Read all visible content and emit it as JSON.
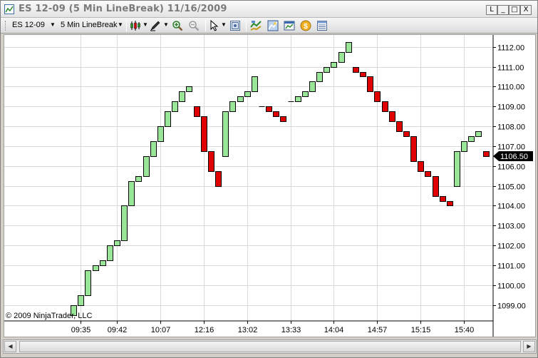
{
  "window": {
    "title": "ES 12-09 (5 Min LineBreak)  11/16/2009",
    "controls": [
      "L",
      "_",
      "□",
      "X"
    ]
  },
  "toolbar": {
    "instrument": "ES 12-09",
    "period": "5 Min LineBreak",
    "icons": [
      "chart-style-icon",
      "draw-pen-icon",
      "zoom-in-icon",
      "zoom-out-icon",
      "pointer-icon",
      "data-box-icon",
      "indicators-icon",
      "strategies-icon",
      "properties-icon",
      "order-icon",
      "list-icon"
    ]
  },
  "chart": {
    "copyright": "© 2009 NinjaTrader, LLC",
    "current_price": "1106.50",
    "colors": {
      "up": "#99e699",
      "down": "#e00000",
      "grid": "#d8d8d8",
      "price_marker": "#000000"
    }
  },
  "chart_data": {
    "type": "line_break",
    "title": "ES 12-09 (5 Min LineBreak)",
    "y_ticks": [
      1099,
      1100,
      1101,
      1102,
      1103,
      1104,
      1105,
      1106,
      1107,
      1108,
      1109,
      1110,
      1111,
      1112
    ],
    "y_tick_labels": [
      "1099.00",
      "1100.00",
      "1101.00",
      "1102.00",
      "1103.00",
      "1104.00",
      "1105.00",
      "1106.00",
      "1107.00",
      "1108.00",
      "1109.00",
      "1110.00",
      "1111.00",
      "1112.00"
    ],
    "ylim": [
      1098.2,
      1112.6
    ],
    "x_labels": [
      "09:35",
      "09:42",
      "10:07",
      "12:16",
      "13:02",
      "13:33",
      "14:04",
      "14:57",
      "15:15",
      "15:40"
    ],
    "x_label_slots": [
      1,
      6,
      12,
      18,
      24,
      30,
      36,
      42,
      48,
      54
    ],
    "slot_count": 60,
    "bricks": [
      {
        "o": 1098.5,
        "c": 1099.0,
        "dir": "up"
      },
      {
        "o": 1099.0,
        "c": 1099.5,
        "dir": "up"
      },
      {
        "o": 1099.5,
        "c": 1100.75,
        "dir": "up"
      },
      {
        "o": 1100.75,
        "c": 1101.0,
        "dir": "up"
      },
      {
        "o": 1101.0,
        "c": 1101.25,
        "dir": "up"
      },
      {
        "o": 1101.25,
        "c": 1102.0,
        "dir": "up"
      },
      {
        "o": 1102.0,
        "c": 1102.25,
        "dir": "up"
      },
      {
        "o": 1102.25,
        "c": 1104.0,
        "dir": "up"
      },
      {
        "o": 1104.0,
        "c": 1105.25,
        "dir": "up"
      },
      {
        "o": 1105.25,
        "c": 1105.5,
        "dir": "up"
      },
      {
        "o": 1105.5,
        "c": 1106.5,
        "dir": "up"
      },
      {
        "o": 1106.5,
        "c": 1107.25,
        "dir": "up"
      },
      {
        "o": 1107.25,
        "c": 1108.0,
        "dir": "up"
      },
      {
        "o": 1108.0,
        "c": 1108.75,
        "dir": "up"
      },
      {
        "o": 1108.75,
        "c": 1109.25,
        "dir": "up"
      },
      {
        "o": 1109.25,
        "c": 1109.75,
        "dir": "up"
      },
      {
        "o": 1109.75,
        "c": 1110.0,
        "dir": "up"
      },
      {
        "o": 1109.0,
        "c": 1108.5,
        "dir": "down"
      },
      {
        "o": 1108.5,
        "c": 1106.75,
        "dir": "down"
      },
      {
        "o": 1106.75,
        "c": 1105.75,
        "dir": "down"
      },
      {
        "o": 1105.75,
        "c": 1105.0,
        "dir": "down"
      },
      {
        "o": 1106.5,
        "c": 1108.75,
        "dir": "up"
      },
      {
        "o": 1108.75,
        "c": 1109.25,
        "dir": "up"
      },
      {
        "o": 1109.25,
        "c": 1109.5,
        "dir": "up"
      },
      {
        "o": 1109.5,
        "c": 1109.75,
        "dir": "up"
      },
      {
        "o": 1109.75,
        "c": 1110.5,
        "dir": "up"
      },
      {
        "o": 1109.0,
        "c": 1109.0,
        "dir": "flat"
      },
      {
        "o": 1109.0,
        "c": 1108.75,
        "dir": "down"
      },
      {
        "o": 1108.75,
        "c": 1108.5,
        "dir": "down"
      },
      {
        "o": 1108.5,
        "c": 1108.25,
        "dir": "down"
      },
      {
        "o": 1109.25,
        "c": 1109.25,
        "dir": "flat"
      },
      {
        "o": 1109.25,
        "c": 1109.5,
        "dir": "up"
      },
      {
        "o": 1109.5,
        "c": 1109.75,
        "dir": "up"
      },
      {
        "o": 1109.75,
        "c": 1110.25,
        "dir": "up"
      },
      {
        "o": 1110.25,
        "c": 1110.75,
        "dir": "up"
      },
      {
        "o": 1110.75,
        "c": 1111.0,
        "dir": "up"
      },
      {
        "o": 1111.0,
        "c": 1111.25,
        "dir": "up"
      },
      {
        "o": 1111.25,
        "c": 1111.75,
        "dir": "up"
      },
      {
        "o": 1111.75,
        "c": 1112.25,
        "dir": "up"
      },
      {
        "o": 1111.0,
        "c": 1110.75,
        "dir": "down"
      },
      {
        "o": 1110.75,
        "c": 1110.5,
        "dir": "down"
      },
      {
        "o": 1110.5,
        "c": 1109.75,
        "dir": "down"
      },
      {
        "o": 1109.75,
        "c": 1109.25,
        "dir": "down"
      },
      {
        "o": 1109.25,
        "c": 1108.75,
        "dir": "down"
      },
      {
        "o": 1108.75,
        "c": 1108.25,
        "dir": "down"
      },
      {
        "o": 1108.25,
        "c": 1107.75,
        "dir": "down"
      },
      {
        "o": 1107.75,
        "c": 1107.5,
        "dir": "down"
      },
      {
        "o": 1107.5,
        "c": 1106.25,
        "dir": "down"
      },
      {
        "o": 1106.25,
        "c": 1105.75,
        "dir": "down"
      },
      {
        "o": 1105.75,
        "c": 1105.5,
        "dir": "down"
      },
      {
        "o": 1105.5,
        "c": 1104.5,
        "dir": "down"
      },
      {
        "o": 1104.5,
        "c": 1104.25,
        "dir": "down"
      },
      {
        "o": 1104.25,
        "c": 1104.0,
        "dir": "down"
      },
      {
        "o": 1105.0,
        "c": 1106.75,
        "dir": "up"
      },
      {
        "o": 1106.75,
        "c": 1107.25,
        "dir": "up"
      },
      {
        "o": 1107.25,
        "c": 1107.5,
        "dir": "up"
      },
      {
        "o": 1107.5,
        "c": 1107.75,
        "dir": "up"
      },
      {
        "o": 1106.75,
        "c": 1106.5,
        "dir": "down"
      }
    ]
  }
}
